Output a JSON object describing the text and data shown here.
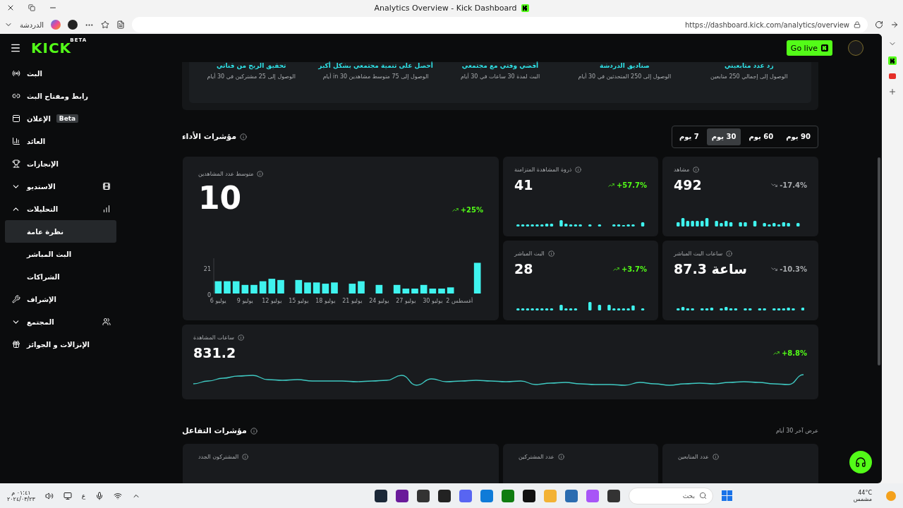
{
  "browser": {
    "title": "Analytics Overview - Kick Dashboard",
    "url": "https://dashboard.kick.com/analytics/overview",
    "chat_label": "الدردشة"
  },
  "header": {
    "logo": "KICK",
    "logo_badge": "BETA",
    "go_live": "Go live"
  },
  "sidebar": {
    "items": [
      {
        "label": "البث"
      },
      {
        "label": "رابط ومفتاح البث"
      },
      {
        "label": "الإعلان",
        "badge": "Beta"
      },
      {
        "label": "العائد"
      },
      {
        "label": "الإنجازات"
      },
      {
        "label": "الاستديو",
        "expanded": false
      },
      {
        "label": "التحليلات",
        "expanded": true,
        "children": [
          {
            "label": "نظرة عامة",
            "selected": true
          },
          {
            "label": "البث المباشر",
            "selected": false
          },
          {
            "label": "الشراكات",
            "selected": false
          }
        ]
      },
      {
        "label": "الإشراف"
      },
      {
        "label": "المجتمع",
        "expanded": false
      },
      {
        "label": "الإنزالات و الجوائز"
      }
    ]
  },
  "goals": [
    {
      "title": "زد عدد متابعيني",
      "detail": "الوصول إلى إجمالي 250 متابعين"
    },
    {
      "title": "صناديق الدردشة",
      "detail": "الوصول إلى 250 المتحدثين في 30 أيام"
    },
    {
      "title": "أقضي وقتي مع مجتمعي",
      "detail": "البث لمدة 30 ساعات في 30 أيام"
    },
    {
      "title": "أحصل على تنمية مجتمعي بشكل أكبر",
      "detail": "الوصول إلى 75 متوسط مشاهدين in 30 أيام"
    },
    {
      "title": "تحقيق الربح من قناتي",
      "detail": "الوصول إلى 25 مشتركين في 30 أيام"
    }
  ],
  "performance": {
    "title": "مؤشرات الأداء",
    "ranges": [
      {
        "label": "90 يوم",
        "selected": false
      },
      {
        "label": "60 يوم",
        "selected": false
      },
      {
        "label": "30 يوم",
        "selected": true
      },
      {
        "label": "7 يوم",
        "selected": false
      }
    ],
    "average": {
      "label": "متوسط عدد المشاهدين",
      "value": "10",
      "change": "+25%",
      "color": "#53fc18",
      "chart_data": {
        "type": "bar",
        "categories": [
          "يوليو 6",
          null,
          null,
          "يوليو 9",
          null,
          null,
          "يوليو 12",
          null,
          null,
          "يوليو 15",
          null,
          null,
          "يوليو 18",
          null,
          null,
          "يوليو 21",
          null,
          null,
          "يوليو 24",
          null,
          null,
          "يوليو 27",
          null,
          null,
          "يوليو 30",
          null,
          null,
          "أغسطس 2",
          null,
          null
        ],
        "values": [
          10,
          10,
          10,
          7,
          7,
          10,
          12,
          11,
          null,
          11,
          9,
          9,
          8,
          9,
          null,
          8,
          10,
          null,
          7,
          null,
          7,
          4,
          4,
          7,
          4,
          4,
          5,
          null,
          null,
          25
        ],
        "ylim": [
          0,
          27
        ],
        "yticks": [
          0,
          21
        ]
      }
    },
    "cards": [
      {
        "label": "مشاهد",
        "value": "492",
        "change": "-17.4%",
        "color": "#a7aaad"
      },
      {
        "label": "ذروة المشاهدة المتزامنة",
        "value": "41",
        "change": "+57.7%",
        "color": "#53fc18"
      },
      {
        "label": "ساعات البث المباشر",
        "value": "87.3 ساعة",
        "change": "-10.3%",
        "color": "#a7aaad"
      },
      {
        "label": "البث المباشر",
        "value": "28",
        "change": "+3.7%",
        "color": "#53fc18"
      }
    ],
    "watch": {
      "label": "ساعات المشاهدة",
      "value": "831.2",
      "change": "+8.8%",
      "color": "#53fc18"
    }
  },
  "engagement": {
    "title": "مؤشرات التفاعل",
    "range_note": "عرض آخر 30 أيام",
    "cards": [
      {
        "label": "عدد المتابعين"
      },
      {
        "label": "عدد المشتركين"
      },
      {
        "label": "المشتركون الجدد"
      }
    ]
  },
  "taskbar": {
    "time": "٠١:٤١ م",
    "date": "٢٠٢٤/٠٣/٢٣",
    "language": "ع",
    "search_placeholder": "بحث",
    "temperature": "44°C",
    "condition": "مشمس"
  }
}
